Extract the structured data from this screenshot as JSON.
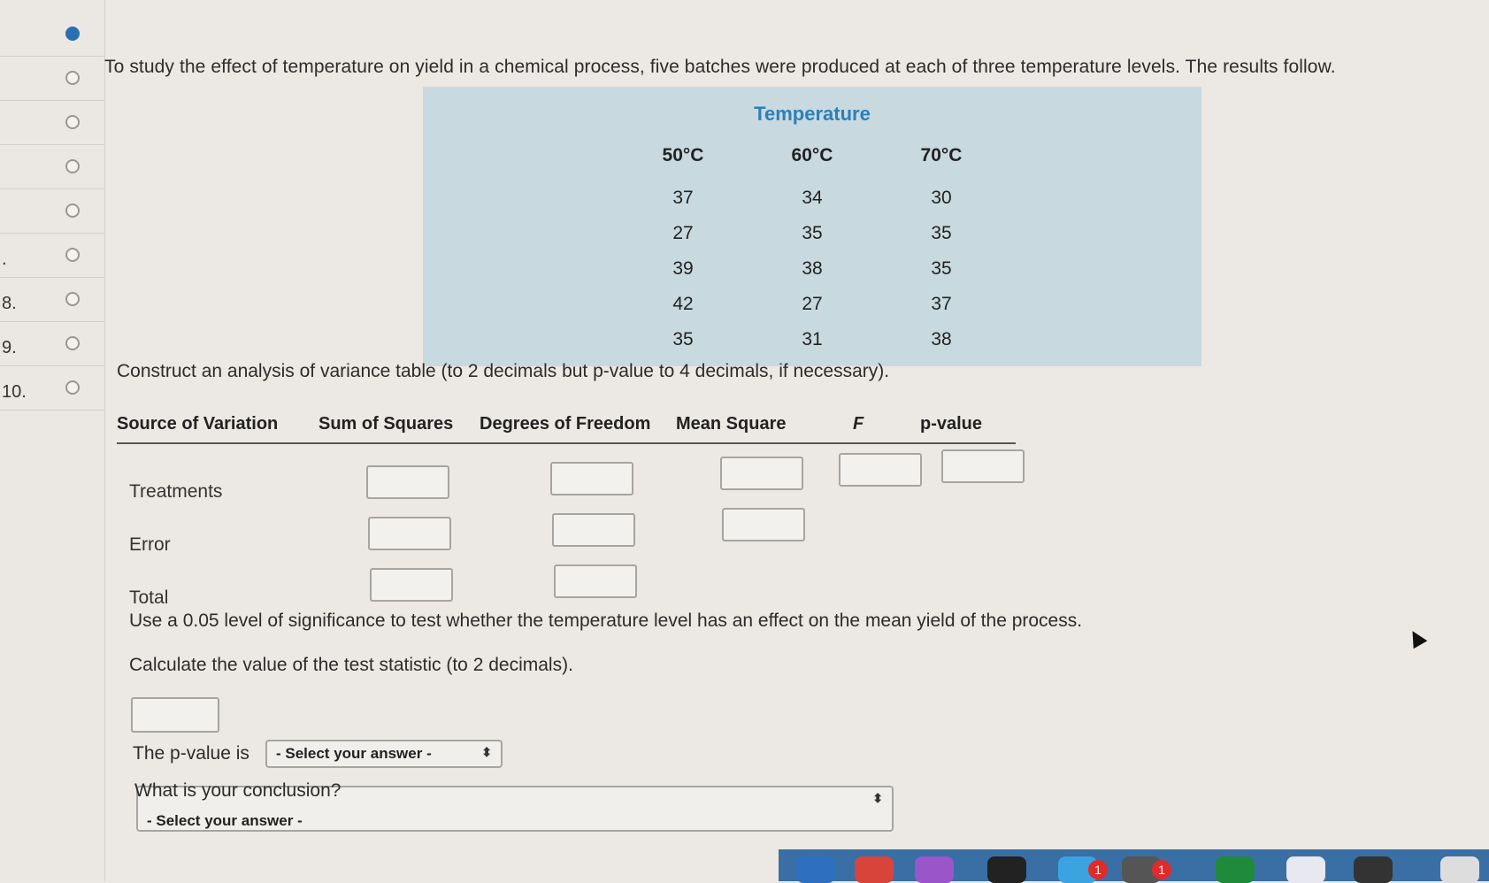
{
  "nav": {
    "items": [
      {
        "num": "",
        "active": true
      },
      {
        "num": "",
        "active": false
      },
      {
        "num": "",
        "active": false
      },
      {
        "num": "",
        "active": false
      },
      {
        "num": "",
        "active": false
      },
      {
        "num": ".",
        "active": false
      },
      {
        "num": "8.",
        "active": false
      },
      {
        "num": "9.",
        "active": false
      },
      {
        "num": "10.",
        "active": false
      }
    ]
  },
  "question": {
    "intro": "To study the effect of temperature on yield in a chemical process, five batches were produced at each of three temperature levels. The results follow.",
    "table": {
      "header": "Temperature",
      "columns": [
        {
          "label": "50°C",
          "values": [
            "37",
            "27",
            "39",
            "42",
            "35"
          ]
        },
        {
          "label": "60°C",
          "values": [
            "34",
            "35",
            "38",
            "27",
            "31"
          ]
        },
        {
          "label": "70°C",
          "values": [
            "30",
            "35",
            "35",
            "37",
            "38"
          ]
        }
      ]
    },
    "construct_text": "Construct an analysis of variance table (to 2 decimals but p-value to 4 decimals, if necessary).",
    "anova": {
      "headers": [
        "Source of Variation",
        "Sum of Squares",
        "Degrees of Freedom",
        "Mean Square",
        "F",
        "p-value"
      ],
      "rows": [
        "Treatments",
        "Error",
        "Total"
      ]
    },
    "significance_text": "Use a 0.05 level of significance to test whether the temperature level has an effect on the mean yield of the process.",
    "calc_text": "Calculate the value of the test statistic (to 2 decimals).",
    "pvalue_label": "The p-value is",
    "pvalue_select": "- Select your answer -",
    "conclusion_label": "What is your conclusion?",
    "conclusion_select": "- Select your answer -"
  },
  "dock": {
    "badges": [
      "1",
      "1"
    ]
  }
}
